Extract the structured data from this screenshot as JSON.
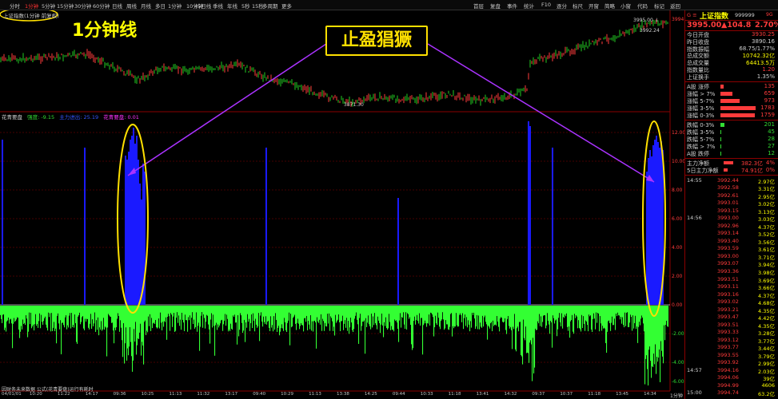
{
  "toolbar": {
    "timeframes": [
      "分时",
      "1分钟",
      "5分钟",
      "15分钟",
      "30分钟",
      "60分钟",
      "日线",
      "周线",
      "月线",
      "多日",
      "1分钟",
      "10分钟",
      "45日线",
      "季线",
      "年线",
      "5秒",
      "15秒",
      "多周期",
      "更多"
    ],
    "active_index": 1,
    "right_tools": [
      "首层",
      "复盘",
      "事件",
      "统计",
      "F10",
      "逐分",
      "标尺",
      "开窗",
      "简略",
      "小窗",
      "代码",
      "标记",
      "返回"
    ]
  },
  "chart": {
    "period_label": "上证指数(1分钟 前复权)",
    "annotation_title": "1分钟线",
    "callout": "止盈猖獗",
    "price_high_label": "3995.00 ↓",
    "price_sub_label": "3992.24",
    "price_low_label": "3871.30",
    "indicator_legend": {
      "name": "花青要盘",
      "items": [
        "强度: -9.15",
        "主力进出: 25.19",
        "花青要盘: 0.01"
      ]
    },
    "y_axis": [
      "3994",
      "12.00",
      "10.00",
      "8.00",
      "6.00",
      "4.00",
      "2.00",
      "0.00",
      "-2.00",
      "-4.00",
      "-6.00"
    ],
    "footer_left": "因财务未来数据  公式(花青要盘)运行有耗时",
    "time_labels": [
      "04/01/01",
      "10:20",
      "11:22",
      "14:17",
      "09:36",
      "10:25",
      "11:13",
      "11:32",
      "13:17",
      "09:40",
      "10:29",
      "11:13",
      "13:38",
      "14:25",
      "09:44",
      "10:33",
      "11:18",
      "13:41",
      "14:32",
      "09:37",
      "10:37",
      "11:18",
      "13:45",
      "14:34"
    ],
    "right_time": "1分钟"
  },
  "quote": {
    "title_code": "G ≡",
    "name": "上证指数",
    "code": "999999",
    "badge": "9G",
    "price": "3995.00",
    "change": "▲104.8",
    "change_pct": "2.70%",
    "fields": [
      {
        "label": "今日开盘",
        "value": "3930.25",
        "color": "red"
      },
      {
        "label": "昨日收盘",
        "value": "3890.16",
        "color": "white"
      },
      {
        "label": "指数振幅",
        "value": "68.75/1.77%",
        "color": "white"
      },
      {
        "label": "总成交额",
        "value": "10742.32亿",
        "color": "yel"
      },
      {
        "label": "总成交量",
        "value": "64413.5万",
        "color": "yel"
      },
      {
        "label": "指数量比",
        "value": "1.20",
        "color": "red"
      },
      {
        "label": "上证换手",
        "value": "1.35%",
        "color": "white"
      }
    ],
    "up_dist": [
      {
        "label": "A股 涨停",
        "value": "135",
        "bar": 0.08
      },
      {
        "label": "涨幅 > 7%",
        "value": "659",
        "bar": 0.35
      },
      {
        "label": "涨幅 5-7%",
        "value": "973",
        "bar": 0.55
      },
      {
        "label": "涨幅 3-5%",
        "value": "1783",
        "bar": 1.0
      },
      {
        "label": "涨幅 0-3%",
        "value": "1759",
        "bar": 0.98
      }
    ],
    "down_dist": [
      {
        "label": "跌幅 0-3%",
        "value": "201",
        "bar": 0.12
      },
      {
        "label": "跌幅 3-5%",
        "value": "45",
        "bar": 0.03
      },
      {
        "label": "跌幅 5-7%",
        "value": "28",
        "bar": 0.02
      },
      {
        "label": "跌幅 > 7%",
        "value": "27",
        "bar": 0.02
      },
      {
        "label": "A股 跌停",
        "value": "12",
        "bar": 0.01
      }
    ],
    "flows": [
      {
        "label": "主力净额",
        "value": "382.3亿",
        "pct": "4%"
      },
      {
        "label": "5日主力净额",
        "value": "74.91亿",
        "pct": "0%"
      }
    ],
    "ticks": [
      {
        "t": "14:55",
        "p": "3992.44",
        "v": "2.97亿"
      },
      {
        "t": "",
        "p": "3992.58",
        "v": "3.31亿"
      },
      {
        "t": "",
        "p": "3992.61",
        "v": "2.95亿"
      },
      {
        "t": "",
        "p": "3993.01",
        "v": "3.02亿"
      },
      {
        "t": "",
        "p": "3993.15",
        "v": "3.13亿"
      },
      {
        "t": "14:56",
        "p": "3993.00",
        "v": "3.03亿"
      },
      {
        "t": "",
        "p": "3992.96",
        "v": "4.37亿"
      },
      {
        "t": "",
        "p": "3993.14",
        "v": "3.52亿"
      },
      {
        "t": "",
        "p": "3993.40",
        "v": "3.56亿"
      },
      {
        "t": "",
        "p": "3993.59",
        "v": "3.61亿"
      },
      {
        "t": "",
        "p": "3993.00",
        "v": "3.71亿"
      },
      {
        "t": "",
        "p": "3993.07",
        "v": "3.94亿"
      },
      {
        "t": "",
        "p": "3993.36",
        "v": "3.98亿"
      },
      {
        "t": "",
        "p": "3993.51",
        "v": "3.69亿"
      },
      {
        "t": "",
        "p": "3993.11",
        "v": "3.66亿"
      },
      {
        "t": "",
        "p": "3993.16",
        "v": "4.37亿"
      },
      {
        "t": "",
        "p": "3993.02",
        "v": "4.68亿"
      },
      {
        "t": "",
        "p": "3993.21",
        "v": "4.35亿"
      },
      {
        "t": "",
        "p": "3993.47",
        "v": "4.42亿"
      },
      {
        "t": "",
        "p": "3993.51",
        "v": "4.35亿"
      },
      {
        "t": "",
        "p": "3993.33",
        "v": "3.28亿"
      },
      {
        "t": "",
        "p": "3993.12",
        "v": "3.77亿"
      },
      {
        "t": "",
        "p": "3993.77",
        "v": "3.44亿"
      },
      {
        "t": "",
        "p": "3993.55",
        "v": "3.79亿"
      },
      {
        "t": "",
        "p": "3993.92",
        "v": "2.99亿"
      },
      {
        "t": "14:57",
        "p": "3994.16",
        "v": "2.03亿"
      },
      {
        "t": "",
        "p": "3994.06",
        "v": "39亿"
      },
      {
        "t": "",
        "p": "3994.99",
        "v": "4606"
      },
      {
        "t": "15:00",
        "p": "3994.74",
        "v": "63.2亿"
      }
    ]
  }
}
